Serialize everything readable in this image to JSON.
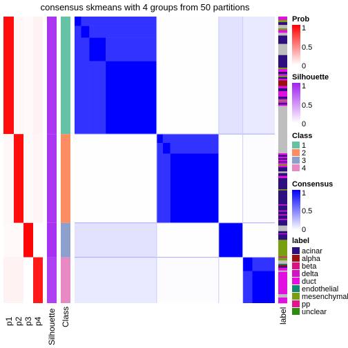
{
  "title": "consensus skmeans with 4 groups from 50 partitions",
  "chart_data": {
    "type": "heatmap",
    "title": "consensus skmeans with 4 groups from 50 partitions",
    "n_groups": 4,
    "n_partitions": 50,
    "annotation_columns": [
      "p1",
      "p2",
      "p3",
      "p4",
      "Silhouette",
      "Class"
    ],
    "label_column": "label",
    "classes": [
      {
        "class": "1",
        "fraction": 0.41,
        "prob": [
          0.95,
          0.03,
          0.02,
          0.05
        ],
        "silhouette": 0.9,
        "subclusters": [
          0.08,
          0.1,
          0.2,
          0.62
        ],
        "offdiag_consensus": {
          "2": 0.02,
          "3": 0.45,
          "4": 0.35
        }
      },
      {
        "class": "2",
        "fraction": 0.31,
        "prob": [
          0.03,
          0.95,
          0.02,
          0.04
        ],
        "silhouette": 0.9,
        "subclusters": [
          0.1,
          0.12,
          0.78
        ],
        "offdiag_consensus": {
          "1": 0.02,
          "3": 0.02,
          "4": 0.05
        }
      },
      {
        "class": "3",
        "fraction": 0.12,
        "prob": [
          0.02,
          0.02,
          0.98,
          0.0
        ],
        "silhouette": 0.92,
        "subclusters": [
          1.0
        ],
        "offdiag_consensus": {
          "1": 0.45,
          "2": 0.02,
          "4": 0.02
        }
      },
      {
        "class": "4",
        "fraction": 0.16,
        "prob": [
          0.05,
          0.05,
          0.0,
          0.9
        ],
        "silhouette": 0.85,
        "subclusters": [
          0.3,
          0.7
        ],
        "offdiag_consensus": {
          "1": 0.35,
          "2": 0.05,
          "3": 0.02
        }
      }
    ],
    "legends": {
      "prob": {
        "title": "Prob",
        "ticks": [
          "1",
          "0.5",
          "0"
        ],
        "range": [
          0,
          1
        ],
        "color_high": "#FF0000",
        "color_low": "#FFFFFF"
      },
      "silhouette": {
        "title": "Silhouette",
        "ticks": [
          "1",
          "0.5",
          "0"
        ],
        "range": [
          0,
          1
        ],
        "color_high": "#A020F0",
        "color_low": "#FFFFFF"
      },
      "class": {
        "title": "Class",
        "items": [
          {
            "label": "1",
            "color": "#66C2A5"
          },
          {
            "label": "2",
            "color": "#FC8D62"
          },
          {
            "label": "3",
            "color": "#8DA0CB"
          },
          {
            "label": "4",
            "color": "#E78AC3"
          }
        ]
      },
      "consensus": {
        "title": "Consensus",
        "ticks": [
          "1",
          "0.5",
          "0"
        ],
        "range": [
          0,
          1
        ],
        "color_high": "#0000FF",
        "color_low": "#FFFFFF"
      },
      "label": {
        "title": "label",
        "items": [
          {
            "label": "acinar",
            "color": "#2E0F7E"
          },
          {
            "label": "alpha",
            "color": "#9B0F0F"
          },
          {
            "label": "beta",
            "color": "#D9137E"
          },
          {
            "label": "delta",
            "color": "#D414C4"
          },
          {
            "label": "duct",
            "color": "#E010E0"
          },
          {
            "label": "endothelial",
            "color": "#0F8A6A"
          },
          {
            "label": "mesenchymal",
            "color": "#7A9E12"
          },
          {
            "label": "pp",
            "color": "#E0168A"
          },
          {
            "label": "unclear",
            "color": "#2E8A12"
          }
        ]
      }
    },
    "label_column_segments": [
      [
        "duct",
        0.012
      ],
      [
        "mesenchymal",
        0.008
      ],
      [
        "acinar",
        0.01
      ],
      [
        "grey",
        0.012
      ],
      [
        "mesenchymal",
        0.006
      ],
      [
        "duct",
        0.01
      ],
      [
        "grey",
        0.01
      ],
      [
        "acinar",
        0.03
      ],
      [
        "grey",
        0.04
      ],
      [
        "acinar",
        0.045
      ],
      [
        "mesenchymal",
        0.005
      ],
      [
        "duct",
        0.01
      ],
      [
        "acinar",
        0.008
      ],
      [
        "duct",
        0.006
      ],
      [
        "mesenchymal",
        0.005
      ],
      [
        "acinar",
        0.006
      ],
      [
        "duct",
        0.006
      ],
      [
        "alpha",
        0.02
      ],
      [
        "duct",
        0.008
      ],
      [
        "acinar",
        0.01
      ],
      [
        "duct",
        0.02
      ],
      [
        "acinar",
        0.008
      ],
      [
        "duct",
        0.005
      ],
      [
        "mesenchymal",
        0.004
      ],
      [
        "duct",
        0.006
      ],
      [
        "acinar",
        0.005
      ],
      [
        "duct",
        0.005
      ],
      [
        "grey",
        0.17
      ],
      [
        "duct",
        0.006
      ],
      [
        "acinar",
        0.006
      ],
      [
        "duct",
        0.006
      ],
      [
        "acinar",
        0.005
      ],
      [
        "duct",
        0.006
      ],
      [
        "acinar",
        0.004
      ],
      [
        "duct",
        0.006
      ],
      [
        "mesenchymal",
        0.005
      ],
      [
        "duct",
        0.006
      ],
      [
        "acinar",
        0.015
      ],
      [
        "grey",
        0.006
      ],
      [
        "acinar",
        0.01
      ],
      [
        "duct",
        0.008
      ],
      [
        "acinar",
        0.04
      ],
      [
        "mesenchymal",
        0.004
      ],
      [
        "acinar",
        0.05
      ],
      [
        "duct",
        0.004
      ],
      [
        "acinar",
        0.018
      ],
      [
        "duct",
        0.004
      ],
      [
        "acinar",
        0.01
      ],
      [
        "duct",
        0.004
      ],
      [
        "acinar",
        0.012
      ],
      [
        "duct",
        0.004
      ],
      [
        "acinar",
        0.02
      ],
      [
        "grey",
        0.02
      ],
      [
        "acinar",
        0.008
      ],
      [
        "duct",
        0.003
      ],
      [
        "acinar",
        0.02
      ],
      [
        "mesenchymal",
        0.06
      ],
      [
        "pp",
        0.004
      ],
      [
        "mesenchymal",
        0.01
      ],
      [
        "grey",
        0.012
      ],
      [
        "endothelial",
        0.004
      ],
      [
        "alpha",
        0.005
      ],
      [
        "acinar",
        0.005
      ],
      [
        "duct",
        0.01
      ],
      [
        "grey",
        0.005
      ],
      [
        "duct",
        0.08
      ],
      [
        "grey",
        0.012
      ],
      [
        "duct",
        0.02
      ]
    ]
  },
  "axis_labels": {
    "p1": "p1",
    "p2": "p2",
    "p3": "p3",
    "p4": "p4",
    "silhouette": "Silhouette",
    "class": "Class",
    "label": "label"
  }
}
